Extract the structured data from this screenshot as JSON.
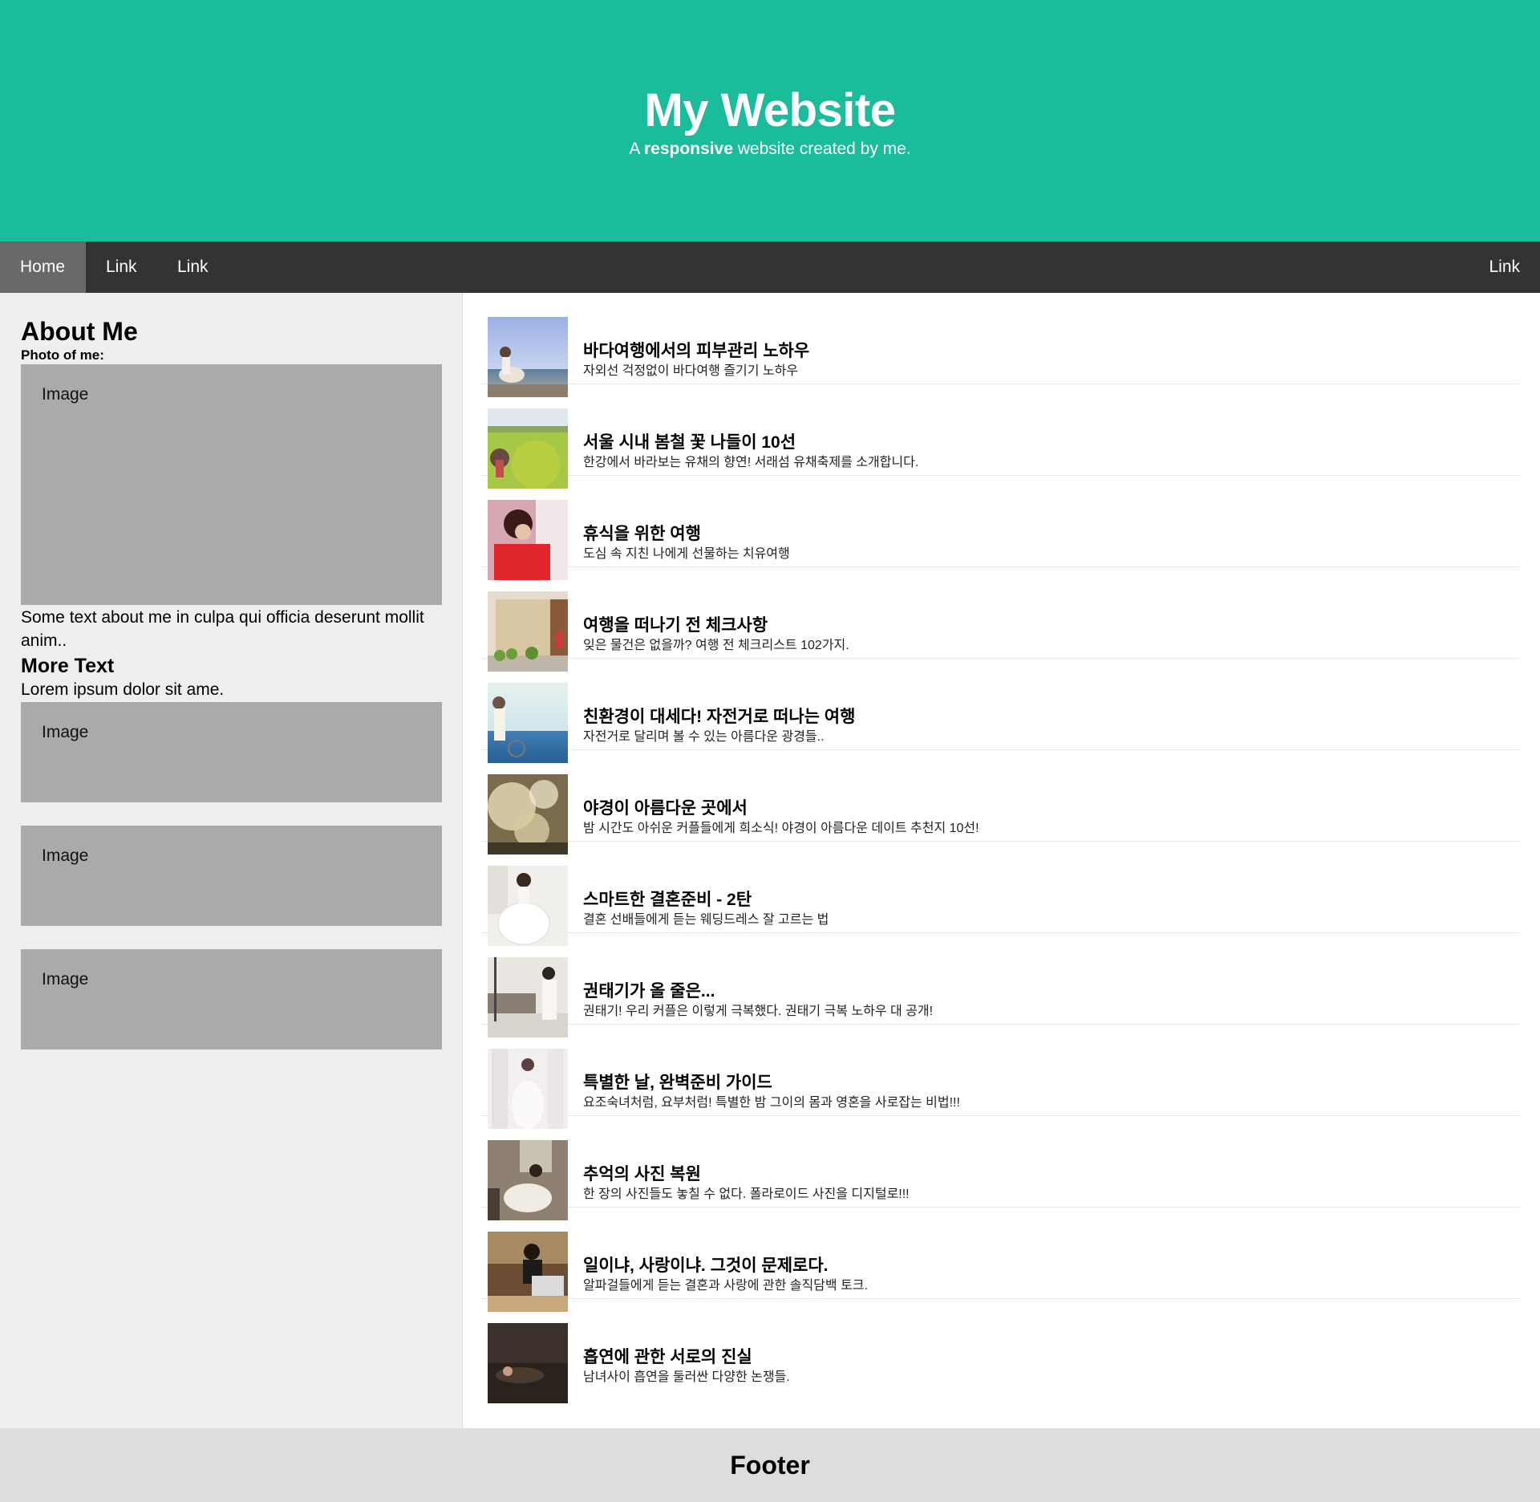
{
  "header": {
    "title": "My Website",
    "tagline_prefix": "A ",
    "tagline_bold": "responsive",
    "tagline_suffix": " website created by me."
  },
  "navbar": {
    "items": [
      {
        "label": "Home"
      },
      {
        "label": "Link"
      },
      {
        "label": "Link"
      },
      {
        "label": "Link"
      }
    ]
  },
  "side": {
    "heading": "About Me",
    "photo_label": "Photo of me:",
    "image_label": "Image",
    "about_text": "Some text about me in culpa qui officia deserunt mollit anim..",
    "more_heading": "More Text",
    "more_text": "Lorem ipsum dolor sit ame.",
    "small_images": [
      "Image",
      "Image",
      "Image"
    ]
  },
  "posts": [
    {
      "title": "바다여행에서의 피부관리 노하우",
      "subtitle": "자외선 걱정없이 바다여행 즐기기 노하우"
    },
    {
      "title": "서울 시내 봄철 꽃 나들이 10선",
      "subtitle": "한강에서 바라보는 유채의 향연! 서래섬 유채축제를 소개합니다."
    },
    {
      "title": "휴식을 위한 여행",
      "subtitle": "도심 속 지친 나에게 선물하는 치유여행"
    },
    {
      "title": "여행을 떠나기 전 체크사항",
      "subtitle": "잊은 물건은 없을까? 여행 전 체크리스트 102가지."
    },
    {
      "title": "친환경이 대세다! 자전거로 떠나는 여행",
      "subtitle": "자전거로 달리며 볼 수 있는 아름다운 광경들.."
    },
    {
      "title": "야경이 아름다운 곳에서",
      "subtitle": "밤 시간도 아쉬운 커플들에게 희소식! 야경이 아름다운 데이트 추천지 10선!"
    },
    {
      "title": "스마트한 결혼준비 - 2탄",
      "subtitle": "결혼 선배들에게 듣는 웨딩드레스 잘 고르는 법"
    },
    {
      "title": "권태기가 올 줄은...",
      "subtitle": "권태기! 우리 커플은 이렇게 극복했다. 권태기 극복 노하우 대 공개!"
    },
    {
      "title": "특별한 날, 완벽준비 가이드",
      "subtitle": "요조숙녀처럼, 요부처럼! 특별한 밤 그이의 몸과 영혼을 사로잡는 비법!!!"
    },
    {
      "title": "추억의 사진 복원",
      "subtitle": "한 장의 사진들도 놓칠 수 없다. 폴라로이드 사진을 디지털로!!!"
    },
    {
      "title": "일이냐, 사랑이냐. 그것이 문제로다.",
      "subtitle": "알파걸들에게 듣는 결혼과 사랑에 관한 솔직담백 토크."
    },
    {
      "title": "흡연에 관한 서로의 진실",
      "subtitle": "남녀사이 흡연을 둘러싼 다양한 논쟁들."
    }
  ],
  "footer": {
    "label": "Footer"
  }
}
